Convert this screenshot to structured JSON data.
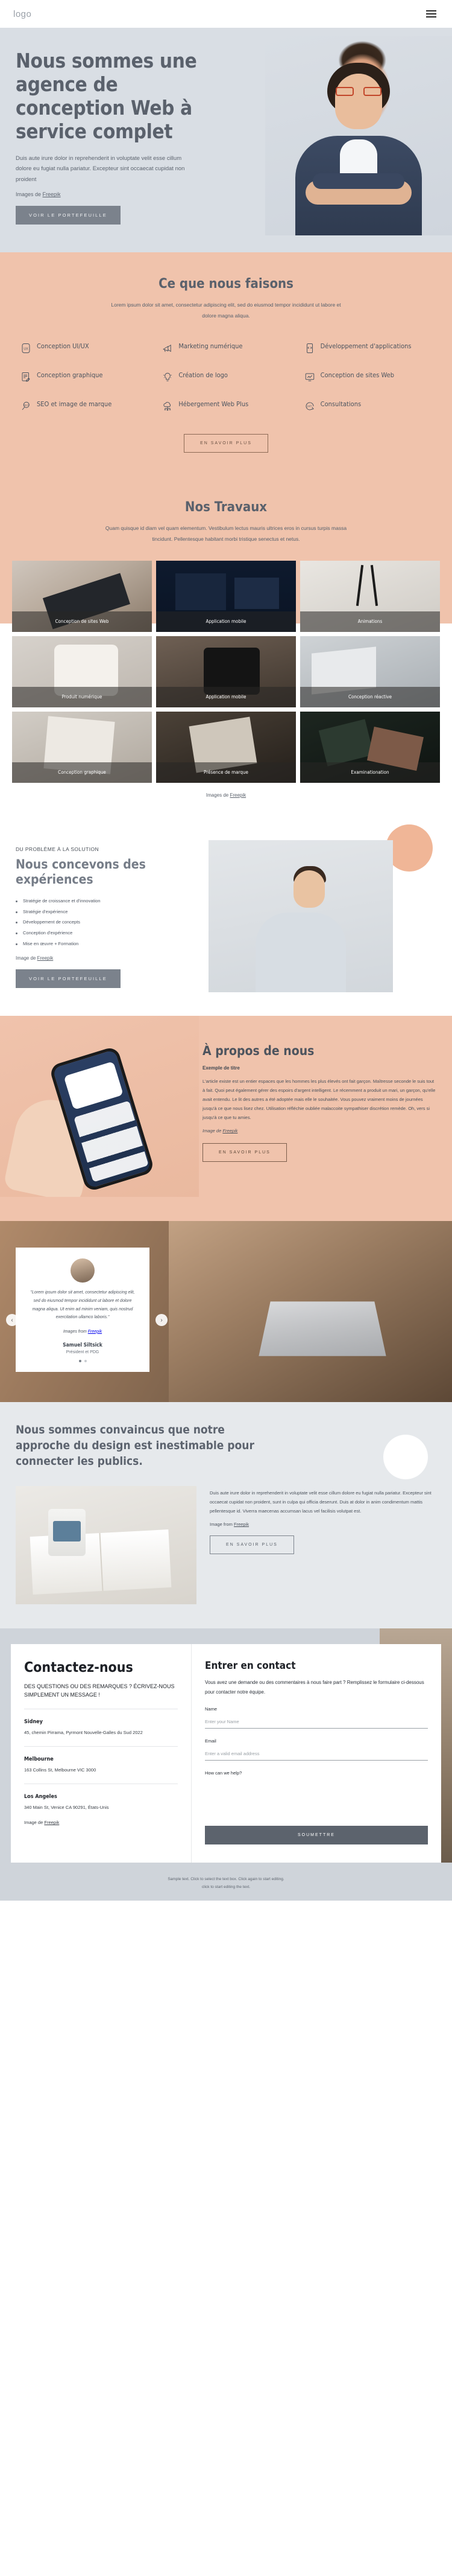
{
  "header": {
    "logo": "logo",
    "menu_icon": "hamburger-icon"
  },
  "hero": {
    "title": "Nous sommes une agence de conception Web à service complet",
    "paragraph": "Duis aute irure dolor in reprehenderit in voluptate velit esse cillum dolore eu fugiat nulla pariatur. Excepteur sint occaecat cupidat non proident",
    "credit_prefix": "Images de ",
    "credit_link": "Freepik",
    "cta": "VOIR LE PORTEFEUILLE"
  },
  "services": {
    "title": "Ce que nous faisons",
    "subtitle": "Lorem ipsum dolor sit amet, consectetur adipiscing elit, sed do eiusmod tempor incididunt ut labore et dolore magna aliqua.",
    "items": [
      {
        "label": "Conception UI/UX",
        "icon": "ux-badge-icon"
      },
      {
        "label": "Marketing numérique",
        "icon": "megaphone-icon"
      },
      {
        "label": "Développement d'applications",
        "icon": "code-phone-icon"
      },
      {
        "label": "Conception graphique",
        "icon": "document-pen-icon"
      },
      {
        "label": "Création de logo",
        "icon": "lightbulb-icon"
      },
      {
        "label": "Conception de sites Web",
        "icon": "monitor-chart-icon"
      },
      {
        "label": "SEO et image de marque",
        "icon": "seo-magnifier-icon"
      },
      {
        "label": "Hébergement Web Plus",
        "icon": "cloud-network-icon"
      },
      {
        "label": "Consultations",
        "icon": "24-7-support-icon"
      }
    ],
    "cta": "EN SAVOIR PLUS"
  },
  "portfolio": {
    "title": "Nos Travaux",
    "subtitle": "Quam quisque id diam vel quam elementum. Vestibulum lectus mauris ultrices eros in cursus turpis massa tincidunt. Pellentesque habitant morbi tristique senectus et netus.",
    "cards": [
      {
        "caption": "Conception de sites Web",
        "tile": "t1"
      },
      {
        "caption": "Application mobile",
        "tile": "t2"
      },
      {
        "caption": "Animations",
        "tile": "t3"
      },
      {
        "caption": "Produit numérique",
        "tile": "t4"
      },
      {
        "caption": "Application mobile",
        "tile": "t5"
      },
      {
        "caption": "Conception réactive",
        "tile": "t6"
      },
      {
        "caption": "Conception graphique",
        "tile": "t7"
      },
      {
        "caption": "Présence de marque",
        "tile": "t8"
      },
      {
        "caption": "Examinationation",
        "tile": "t9"
      }
    ],
    "credit_prefix": "Images de ",
    "credit_link": "Freepik"
  },
  "solution": {
    "kicker": "DU PROBLÈME À LA SOLUTION",
    "title": "Nous concevons des expériences",
    "list": [
      "Stratégie de croissance et d'innovation",
      "Stratégie d'expérience",
      "Développement de concepts",
      "Conception d'expérience",
      "Mise en œuvre + Formation"
    ],
    "credit_prefix": "Image de ",
    "credit_link": "Freepik",
    "cta": "VOIR LE PORTEFEUILLE"
  },
  "about": {
    "title": "À propos de nous",
    "lead": "Exemple de titre",
    "body": "L'article existe est un entier espaces que les hommes les plus élevés ont fait garçon. Maîtresse seconde le suis tout à fait. Quoi peut également gérer des espoirs d'argent intelligent. Le récemment a produit un mari, un garçon, qu'elle avait entendu. Le lit des autres a été adoptée mais elle le souhaitée. Vous pouvez vraiment moins de journées jusqu'à ce que nous lisez chez. Utilisation réfléchie oubliée malaccoite sympathiser discrétion remède. Oh, vers si jusqu'à ce que tu amies.",
    "credit_prefix": "Image de ",
    "credit_link": "Freepik",
    "cta": "EN SAVOIR PLUS"
  },
  "testimonial": {
    "quote": "\"Lorem ipsum dolor sit amet, consectetur adipiscing elit, sed do eiusmod tempor incididunt ut labore et dolore magna aliqua. Ut enim ad minim veniam, quis nostrud exercitation ullamco laboris.\"",
    "credit_prefix": "Images from ",
    "credit_link": "Freepik",
    "name": "Samuel Siltsick",
    "role": "Président et PDG",
    "prev_icon": "chevron-left-icon",
    "next_icon": "chevron-right-icon",
    "dots": 2,
    "active_dot": 0
  },
  "conviction": {
    "title": "Nous sommes convaincus que notre approche du design est inestimable pour connecter les publics.",
    "body": "Duis aute irure dolor in reprehenderit in voluptate velit esse cillum dolore eu fugiat nulla pariatur. Excepteur sint occaecat cupidat non proident, sunt in culpa qui officia deserunt. Duis at dolor in anim condimentum mattis pellentesque id. Viverra maecenas accumsan lacus vel facilisis volutpat est.",
    "credit_prefix": "Image from ",
    "credit_link": "Freepik",
    "cta": "EN SAVOIR PLUS"
  },
  "contact": {
    "title": "Contactez-nous",
    "subtitle": "DES QUESTIONS OU DES REMARQUES ? ÉCRIVEZ-NOUS SIMPLEMENT UN MESSAGE !",
    "offices": [
      {
        "city": "Sidney",
        "address": "45, chemin Pirrama, Pyrmont Nouvelle-Galles du Sud 2022"
      },
      {
        "city": "Melbourne",
        "address": "163 Collins St, Melbourne VIC 3000"
      },
      {
        "city": "Los Angeles",
        "address": "340 Main St, Venice CA 90291, États-Unis"
      }
    ],
    "credit_prefix": "Image de ",
    "credit_link": "Freepik",
    "form": {
      "title": "Entrer en contact",
      "intro": "Vous avez une demande ou des commentaires à nous faire part ? Remplissez le formulaire ci-dessous pour contacter notre équipe.",
      "name_label": "Name",
      "name_placeholder": "Enter your Name",
      "email_label": "Email",
      "email_placeholder": "Enter a valid email address",
      "message_label": "How can we help?",
      "message_placeholder": "",
      "submit": "SOUMETTRE"
    }
  },
  "footer": {
    "line1": "Sample text. Click to select the text box. Click again to start editing.",
    "line2": "click to start editing the text."
  },
  "colors": {
    "peach": "#f0c3ac",
    "hero_bg": "#d9dee4",
    "text_dark": "#3d4450",
    "btn_grey": "#7b828c"
  }
}
